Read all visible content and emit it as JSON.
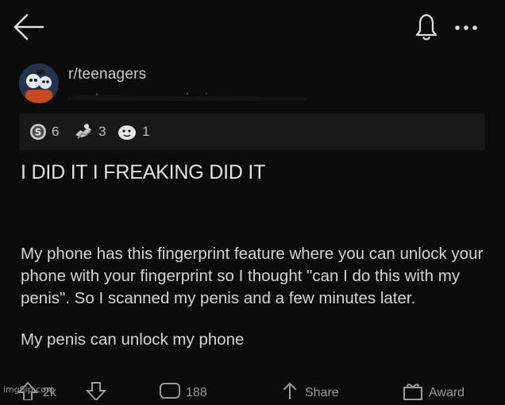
{
  "header": {
    "back_icon": "back-arrow-icon",
    "bell_icon": "bell-icon",
    "more_icon": "more-dots-icon"
  },
  "community": {
    "name": "r/teenagers",
    "avatar_icon": "subreddit-avatar"
  },
  "awards": [
    {
      "icon": "silver-award-icon",
      "count": "6"
    },
    {
      "icon": "helpful-award-icon",
      "count": "3"
    },
    {
      "icon": "wholesome-award-icon",
      "count": "1"
    }
  ],
  "post": {
    "title": "I DID IT I FREAKING DID IT",
    "body_paragraph_1": "My phone has this fingerprint feature where you can unlock your phone with your fingerprint so I thought \"can I do this with my penis\". So I scanned my penis and a few minutes later.",
    "body_paragraph_2": "My penis can unlock my phone"
  },
  "actions": {
    "upvote_count": "2k",
    "comments_count": "188",
    "share_label": "Share",
    "award_label": "Award"
  },
  "watermark": "imgflip.com",
  "colors": {
    "background": "#0b0b0b",
    "awards_strip": "#181818",
    "text_primary": "#e2e2e2",
    "text_secondary": "#c9c9c9"
  }
}
